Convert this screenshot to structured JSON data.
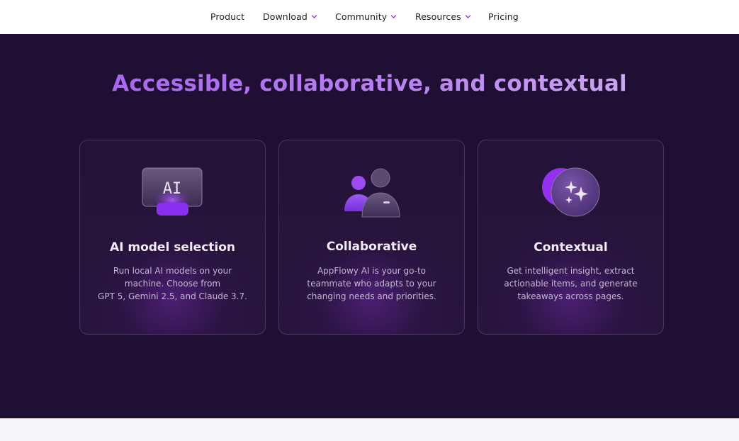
{
  "nav": {
    "items": [
      {
        "label": "Product",
        "has_dropdown": false
      },
      {
        "label": "Download",
        "has_dropdown": true
      },
      {
        "label": "Community",
        "has_dropdown": true
      },
      {
        "label": "Resources",
        "has_dropdown": true
      },
      {
        "label": "Pricing",
        "has_dropdown": false
      }
    ]
  },
  "hero": {
    "title": "Accessible, collaborative, and contextual"
  },
  "cards": [
    {
      "icon": "ai-chip-icon",
      "icon_text": "AI",
      "title": "AI model selection",
      "desc_lines": [
        "Run local AI models on your",
        "machine. Choose from",
        "GPT 5, Gemini 2.5, and Claude 3.7."
      ]
    },
    {
      "icon": "users-icon",
      "title": "Collaborative",
      "desc_lines": [
        "AppFlowy AI is your go-to",
        "teammate who adapts to your",
        "changing needs and priorities."
      ]
    },
    {
      "icon": "sparkles-icon",
      "title": "Contextual",
      "desc_lines": [
        "Get intelligent insight, extract",
        "actionable items, and generate",
        "takeaways across pages."
      ]
    }
  ],
  "colors": {
    "hero_background": "#1f0f32",
    "accent_purple": "#8b2cf0",
    "title_gradient_start": "#a35cf0",
    "title_gradient_end": "#d3b8f0",
    "card_border": "#4a3760"
  }
}
